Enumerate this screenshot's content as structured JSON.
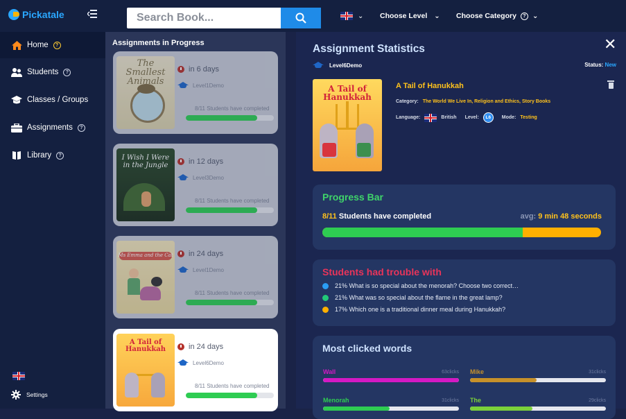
{
  "app": {
    "name": "Pickatale"
  },
  "search": {
    "placeholder": "Search Book..."
  },
  "topbar": {
    "choose_level": "Choose Level",
    "choose_category": "Choose Category"
  },
  "sidebar": {
    "items": [
      {
        "label": "Home",
        "icon": "home-icon",
        "active": true
      },
      {
        "label": "Students",
        "icon": "students-icon"
      },
      {
        "label": "Classes / Groups",
        "icon": "classes-icon"
      },
      {
        "label": "Assignments",
        "icon": "assignments-icon"
      },
      {
        "label": "Library",
        "icon": "library-icon"
      }
    ],
    "settings_label": "Settings"
  },
  "list": {
    "title": "Assignments in Progress",
    "cards": [
      {
        "cover_title": "The Smallest Animals in the World",
        "due": "in 6 days",
        "level": "Level1Demo",
        "progress_text": "8/11 Students have completed",
        "progress": 0.81
      },
      {
        "cover_title": "I Wish I Were in the Jungle",
        "due": "in 12 days",
        "level": "Level3Demo",
        "progress_text": "8/11 Students have completed",
        "progress": 0.81
      },
      {
        "cover_title": "Ms Emma and the Cat",
        "due": "in 24 days",
        "level": "Level1Demo",
        "progress_text": "8/11 Students have completed",
        "progress": 0.81
      },
      {
        "cover_title": "A Tail of Hanukkah",
        "due": "in 24 days",
        "level": "Level6Demo",
        "progress_text": "8/11 Students have completed",
        "progress": 0.81,
        "selected": true
      }
    ]
  },
  "stats": {
    "title": "Assignment Statistics",
    "level": "Level6Demo",
    "status_label": "Status:",
    "status_value": "New",
    "book_title": "A Tail of Hanukkah",
    "cover_title": "A Tail of Hanukkah",
    "category_label": "Category:",
    "category_value": "The World We Live In, Religion and Ethics, Story Books",
    "language_label": "Language:",
    "language_value": "British",
    "level_label": "Level:",
    "level_badge": "L6",
    "mode_label": "Mode:",
    "mode_value": "Testing",
    "progress": {
      "title": "Progress Bar",
      "completed_count": "8/11",
      "completed_text": "Students have completed",
      "avg_label": "avg:",
      "avg_value": "9 min 48 seconds",
      "fraction": 0.72
    },
    "trouble": {
      "title": "Students had trouble with",
      "items": [
        {
          "text": "21% What is so special about the menorah? Choose two correct…",
          "color": "#2a9df4"
        },
        {
          "text": "21% What was so special about the flame in the great lamp?",
          "color": "#22c978"
        },
        {
          "text": "17% Which one is a traditional dinner meal during Hanukkah?",
          "color": "#ffb000"
        }
      ]
    },
    "words": {
      "title": "Most clicked words",
      "items": [
        {
          "word": "Wall",
          "count": "63clicks",
          "fraction": 1.0,
          "color": "#d419c4"
        },
        {
          "word": "Mike",
          "count": "31clicks",
          "fraction": 0.49,
          "color": "#c7912a"
        },
        {
          "word": "Menorah",
          "count": "31clicks",
          "fraction": 0.49,
          "color": "#2ecc52"
        },
        {
          "word": "The",
          "count": "29clicks",
          "fraction": 0.46,
          "color": "#7bd13a"
        }
      ]
    }
  },
  "colors": {
    "accent": "#1f8be8",
    "sidebar": "#142040",
    "yellow": "#ffc21c",
    "green": "#2ecc52",
    "red": "#e8345a"
  }
}
